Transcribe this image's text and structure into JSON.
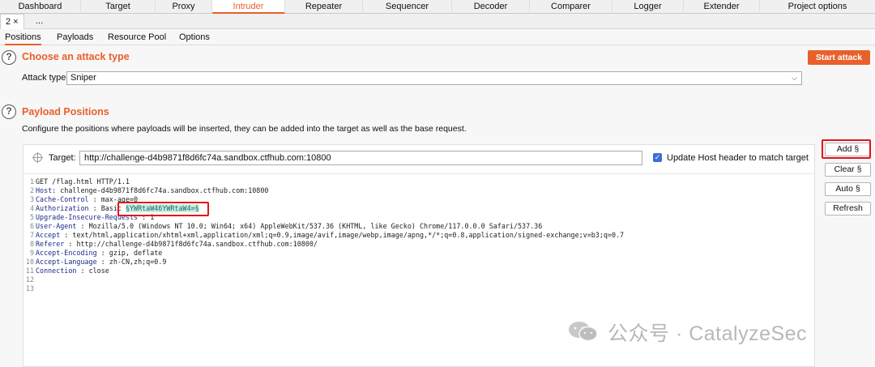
{
  "top_tabs": [
    "Dashboard",
    "Target",
    "Proxy",
    "Intruder",
    "Repeater",
    "Sequencer",
    "Decoder",
    "Comparer",
    "Logger",
    "Extender",
    "Project options"
  ],
  "sub_tabs": {
    "tab1": "2 ×",
    "tab2": "..."
  },
  "inner_tabs": [
    "Positions",
    "Payloads",
    "Resource Pool",
    "Options"
  ],
  "attack_section": {
    "title": "Choose an attack type",
    "start_button": "Start attack",
    "attack_type_label": "Attack type:",
    "attack_type_value": "Sniper"
  },
  "payload_section": {
    "title": "Payload Positions",
    "description": "Configure the positions where payloads will be inserted, they can be added into the target as well as the base request."
  },
  "target": {
    "label": "Target:",
    "value": "http://challenge-d4b9871f8d6fc74a.sandbox.ctfhub.com:10800",
    "update_host_label": "Update Host header to match target",
    "update_host_checked": true
  },
  "side_buttons": {
    "add": "Add §",
    "clear": "Clear §",
    "auto": "Auto §",
    "refresh": "Refresh"
  },
  "request_lines": [
    {
      "n": "1",
      "k": "",
      "v": "GET /flag.html HTTP/1.1"
    },
    {
      "n": "2",
      "k": "Host",
      "v": "challenge-d4b9871f8d6fc74a.sandbox.ctfhub.com:10800"
    },
    {
      "n": "3",
      "k": "Cache-Control",
      "v": "max-age=0"
    },
    {
      "n": "4",
      "k": "Authorization",
      "v": "Basic "
    },
    {
      "n": "5",
      "k": "Upgrade-Insecure-Requests",
      "v": "1"
    },
    {
      "n": "6",
      "k": "User-Agent",
      "v": "Mozilla/5.0 (Windows NT 10.0; Win64; x64) AppleWebKit/537.36 (KHTML, like Gecko) Chrome/117.0.0.0 Safari/537.36"
    },
    {
      "n": "7",
      "k": "Accept",
      "v": "text/html,application/xhtml+xml,application/xml;q=0.9,image/avif,image/webp,image/apng,*/*;q=0.8,application/signed-exchange;v=b3;q=0.7"
    },
    {
      "n": "8",
      "k": "Referer",
      "v": "http://challenge-d4b9871f8d6fc74a.sandbox.ctfhub.com:10800/"
    },
    {
      "n": "9",
      "k": "Accept-Encoding",
      "v": "gzip, deflate"
    },
    {
      "n": "10",
      "k": "Accept-Language",
      "v": "zh-CN,zh;q=0.9"
    },
    {
      "n": "11",
      "k": "Connection",
      "v": "close"
    },
    {
      "n": "12",
      "k": "",
      "v": ""
    },
    {
      "n": "13",
      "k": "",
      "v": ""
    }
  ],
  "payload_marker": "§YWRtaW46YWRtaW4=§",
  "watermark": "公众号 · CatalyzeSec",
  "colors": {
    "accent": "#e8602c",
    "highlight_box": "#e0141e",
    "payload_bg": "#c6f0d6"
  }
}
